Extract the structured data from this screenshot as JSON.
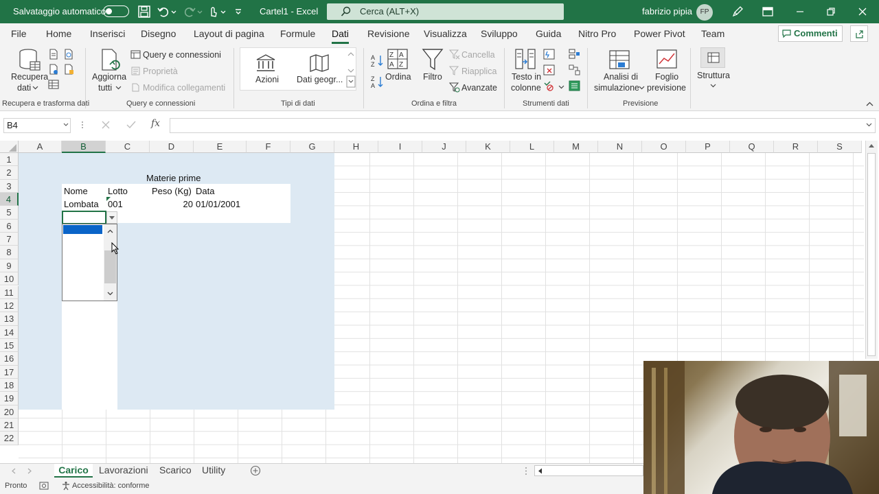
{
  "titlebar": {
    "autosave_label": "Salvataggio automatico",
    "document_title": "Cartel1  -  Excel",
    "search_placeholder": "Cerca (ALT+X)",
    "user_name": "fabrizio pipia",
    "user_initials": "FP",
    "accent_color": "#217346"
  },
  "ribbon_tabs": [
    "File",
    "Home",
    "Inserisci",
    "Disegno",
    "Layout di pagina",
    "Formule",
    "Dati",
    "Revisione",
    "Visualizza",
    "Sviluppo",
    "Guida",
    "Nitro Pro",
    "Power Pivot",
    "Team"
  ],
  "active_tab": "Dati",
  "comments_label": "Commenti",
  "ribbon": {
    "recupera": {
      "line1": "Recupera",
      "line2": "dati",
      "group": "Recupera e trasforma dati"
    },
    "query": {
      "aggiorna_line1": "Aggiorna",
      "aggiorna_line2": "tutti",
      "query_conn": "Query e connessioni",
      "proprieta": "Proprietà",
      "modifica": "Modifica collegamenti",
      "group": "Query e connessioni"
    },
    "tipi": {
      "azioni": "Azioni",
      "geo": "Dati geogr...",
      "group": "Tipi di dati"
    },
    "ordina": {
      "ordina": "Ordina",
      "filtro": "Filtro",
      "cancella": "Cancella",
      "riapplica": "Riapplica",
      "avanzate": "Avanzate",
      "group": "Ordina e filtra"
    },
    "strumenti": {
      "testo_line1": "Testo in",
      "testo_line2": "colonne",
      "group": "Strumenti dati"
    },
    "previsione": {
      "analisi_line1": "Analisi di",
      "analisi_line2": "simulazione",
      "foglio_line1": "Foglio",
      "foglio_line2": "previsione",
      "group": "Previsione"
    },
    "struttura": {
      "label": "Struttura"
    }
  },
  "formula_bar": {
    "name_box": "B4",
    "formula": "",
    "fx": "fx"
  },
  "columns": [
    "A",
    "B",
    "C",
    "D",
    "E",
    "F",
    "G",
    "H",
    "I",
    "J",
    "K",
    "L",
    "M",
    "N",
    "O",
    "P",
    "Q",
    "R",
    "S"
  ],
  "rows": [
    "1",
    "2",
    "3",
    "4",
    "5",
    "6",
    "7",
    "8",
    "9",
    "10",
    "11",
    "12",
    "13",
    "14",
    "15",
    "16",
    "17",
    "18",
    "19",
    "20",
    "21",
    "22"
  ],
  "selected_cell": "B4",
  "sheet": {
    "title": "Materie prime",
    "headers": [
      "Nome",
      "Lotto",
      "Peso (Kg)",
      "Data"
    ],
    "row": [
      "Lombata",
      "001",
      "20",
      "01/01/2001"
    ]
  },
  "sheet_tabs": [
    "Carico",
    "Lavorazioni",
    "Scarico",
    "Utility"
  ],
  "active_sheet": "Carico",
  "status": {
    "ready": "Pronto",
    "accessibility": "Accessibilità: conforme"
  }
}
